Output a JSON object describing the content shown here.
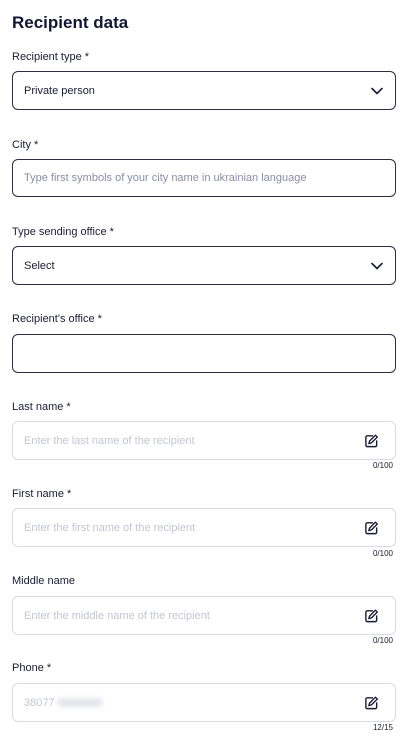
{
  "title": "Recipient data",
  "fields": {
    "recipient_type": {
      "label": "Recipient type *",
      "value": "Private person"
    },
    "city": {
      "label": "City *",
      "placeholder": "Type first symbols of your city name in ukrainian language"
    },
    "sending_office_type": {
      "label": "Type sending office *",
      "value": "Select"
    },
    "recipient_office": {
      "label": "Recipient's office *",
      "value": ""
    },
    "last_name": {
      "label": "Last name *",
      "placeholder": "Enter the last name of the recipient",
      "counter": "0/100"
    },
    "first_name": {
      "label": "First name *",
      "placeholder": "Enter the first name of the recipient",
      "counter": "0/100"
    },
    "middle_name": {
      "label": "Middle name",
      "placeholder": "Enter the middle name of the recipient",
      "counter": "0/100"
    },
    "phone": {
      "label": "Phone *",
      "value": "38077",
      "counter": "12/15"
    }
  },
  "icons": {
    "dropdown": "chevron-down-icon",
    "edit": "edit-icon"
  },
  "colors": {
    "active_border": "#2b2f45",
    "muted_border": "#d9dbe3",
    "placeholder": "#8a8ea6",
    "title": "#121630"
  }
}
